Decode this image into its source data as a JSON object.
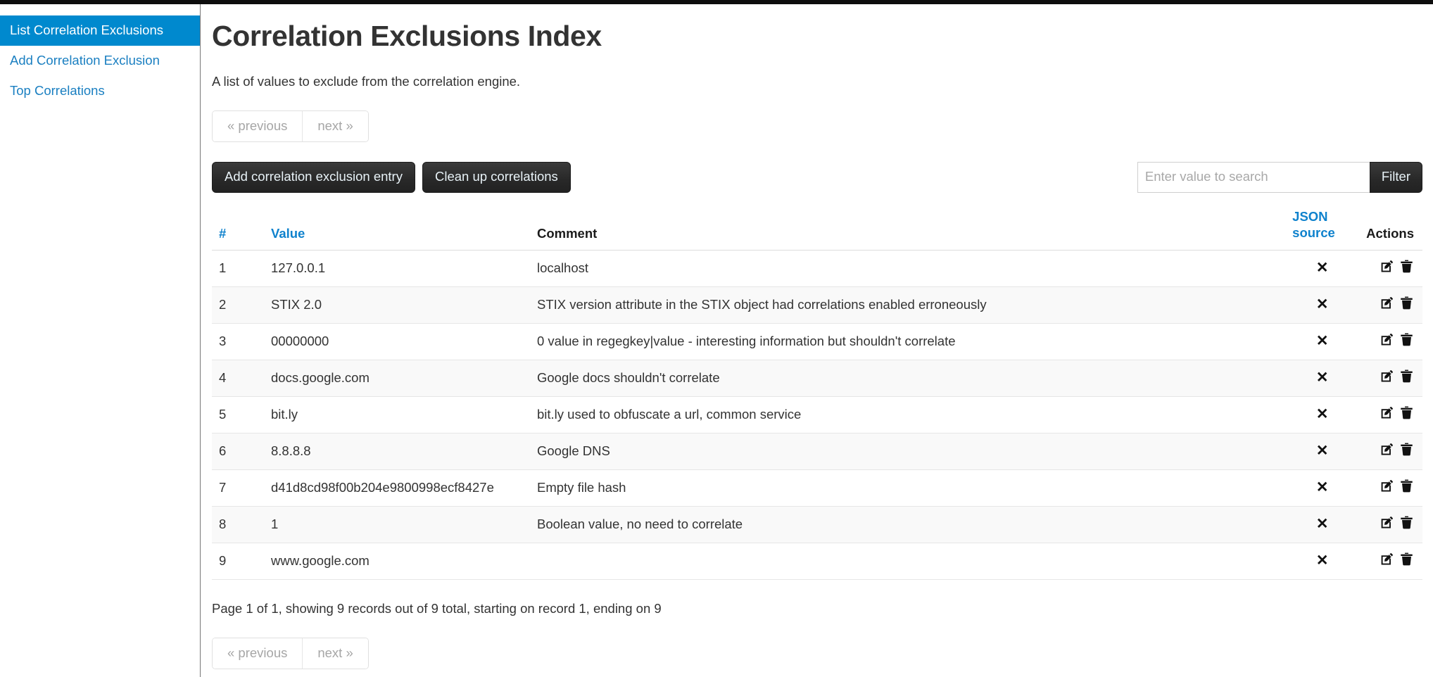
{
  "sidebar": {
    "items": [
      {
        "label": "List Correlation Exclusions",
        "active": true
      },
      {
        "label": "Add Correlation Exclusion",
        "active": false
      },
      {
        "label": "Top Correlations",
        "active": false
      }
    ]
  },
  "main": {
    "title": "Correlation Exclusions Index",
    "description": "A list of values to exclude from the correlation engine.",
    "pagination": {
      "previous_label": "« previous",
      "next_label": "next »"
    },
    "toolbar": {
      "add_entry_label": "Add correlation exclusion entry",
      "cleanup_label": "Clean up correlations",
      "search_placeholder": "Enter value to search",
      "search_value": "",
      "filter_label": "Filter"
    },
    "table": {
      "headers": {
        "index": "#",
        "value": "Value",
        "comment": "Comment",
        "json": "JSON",
        "json_source": "source",
        "actions": "Actions"
      },
      "rows": [
        {
          "index": "1",
          "value": "127.0.0.1",
          "comment": "localhost",
          "json": "✕"
        },
        {
          "index": "2",
          "value": "STIX 2.0",
          "comment": "STIX version attribute in the STIX object had correlations enabled erroneously",
          "json": "✕"
        },
        {
          "index": "3",
          "value": "00000000",
          "comment": "0 value in regegkey|value - interesting information but shouldn't correlate",
          "json": "✕"
        },
        {
          "index": "4",
          "value": "docs.google.com",
          "comment": "Google docs shouldn't correlate",
          "json": "✕"
        },
        {
          "index": "5",
          "value": "bit.ly",
          "comment": "bit.ly used to obfuscate a url, common service",
          "json": "✕"
        },
        {
          "index": "6",
          "value": "8.8.8.8",
          "comment": "Google DNS",
          "json": "✕"
        },
        {
          "index": "7",
          "value": "d41d8cd98f00b204e9800998ecf8427e",
          "comment": "Empty file hash",
          "json": "✕"
        },
        {
          "index": "8",
          "value": "1",
          "comment": "Boolean value, no need to correlate",
          "json": "✕"
        },
        {
          "index": "9",
          "value": "www.google.com",
          "comment": "",
          "json": "✕"
        }
      ]
    },
    "record_info": "Page 1 of 1, showing 9 records out of 9 total, starting on record 1, ending on 9"
  },
  "colors": {
    "accent": "#0089ce",
    "link": "#0f82cd",
    "button_dark": "#282828",
    "topbar": "#0d0d0d"
  }
}
